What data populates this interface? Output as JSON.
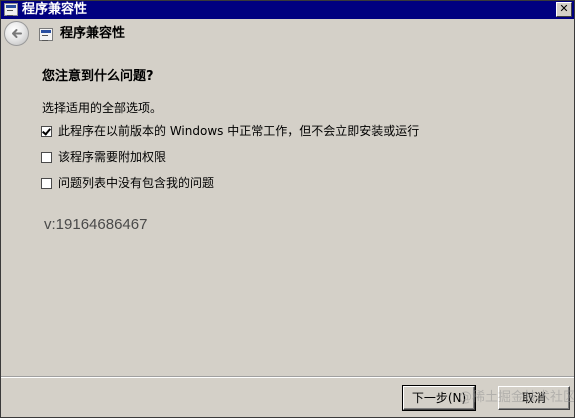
{
  "window": {
    "title": "程序兼容性",
    "app_icon": "program-compat-icon",
    "close_label": "✕"
  },
  "nav": {
    "back_icon": "back-arrow-icon",
    "page_icon": "program-compat-icon",
    "title": "程序兼容性"
  },
  "content": {
    "question": "您注意到什么问题?",
    "instruction": "选择适用的全部选项。",
    "options": [
      {
        "label": "此程序在以前版本的 Windows 中正常工作，但不会立即安装或运行",
        "checked": true
      },
      {
        "label": "该程序需要附加权限",
        "checked": false
      },
      {
        "label": "问题列表中没有包含我的问题",
        "checked": false
      }
    ],
    "version_text": "v:19164686467"
  },
  "footer": {
    "next_label": "下一步(N)",
    "cancel_label": "取消",
    "watermark": "@稀土掘金技术社区"
  },
  "colors": {
    "titlebar_bg": "#000080",
    "window_bg": "#d4d0c8",
    "version_text": "#4a4a4a"
  }
}
